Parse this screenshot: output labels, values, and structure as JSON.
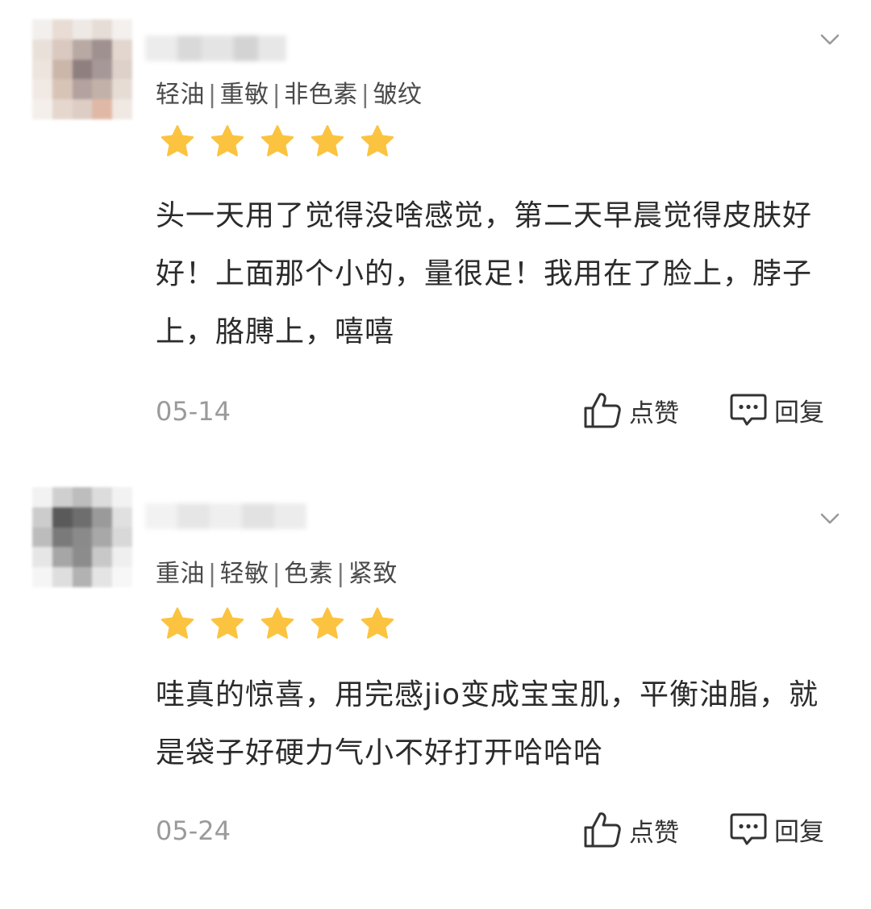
{
  "reviews": [
    {
      "tags": [
        "轻油",
        "重敏",
        "非色素",
        "皱纹"
      ],
      "rating": 5,
      "text": "头一天用了觉得没啥感觉，第二天早晨觉得皮肤好好！上面那个小的，量很足！我用在了脸上，脖子上，胳膊上，嘻嘻",
      "date": "05-14",
      "like_label": "点赞",
      "reply_label": "回复"
    },
    {
      "tags": [
        "重油",
        "轻敏",
        "色素",
        "紧致"
      ],
      "rating": 5,
      "text": "哇真的惊喜，用完感jio变成宝宝肌，平衡油脂，就是袋子好硬力气小不好打开哈哈哈",
      "date": "05-24",
      "like_label": "点赞",
      "reply_label": "回复"
    }
  ],
  "colors": {
    "star": "#FBC33F",
    "date": "#9A9A9A",
    "text": "#2B2B2B"
  },
  "icons": {
    "more": "chevron-down-icon",
    "star": "star-icon",
    "like": "thumbs-up-icon",
    "reply": "comment-bubble-icon"
  }
}
